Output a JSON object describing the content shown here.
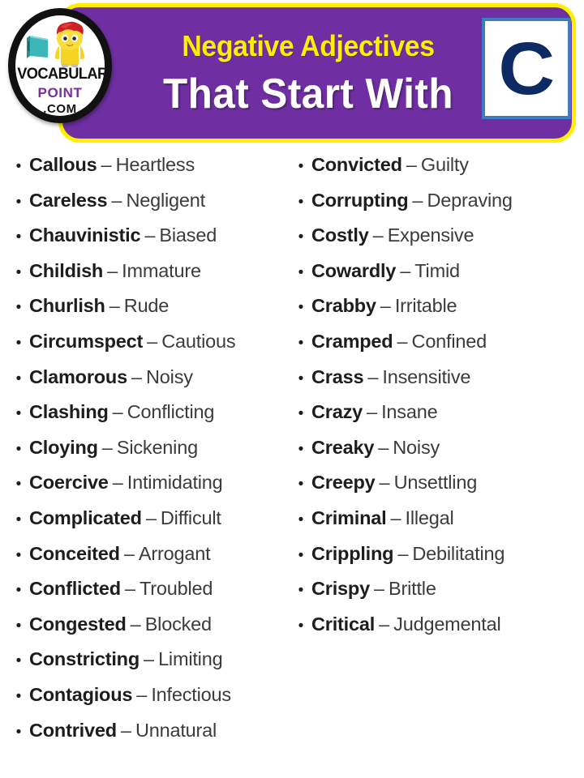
{
  "header": {
    "title_line1": "Negative Adjectives",
    "title_line2": "That Start With",
    "letter": "C",
    "banner_color": "#6f2fa2",
    "banner_border_color": "#ffee00",
    "title_line1_color": "#ffee00",
    "title_line2_color": "#ffffff",
    "letter_color": "#0d2a62",
    "letter_border_color": "#3d7cc0"
  },
  "logo": {
    "word1": "VOCABULARY",
    "word2": "POINT",
    "word3": ".COM",
    "word1_color": "#111111",
    "word2_color": "#7a2f9e",
    "word3_color": "#111111"
  },
  "list": {
    "bullet": "•",
    "dash": "–",
    "left_column": [
      {
        "term": "Callous",
        "meaning": "Heartless"
      },
      {
        "term": "Careless",
        "meaning": "Negligent"
      },
      {
        "term": "Chauvinistic",
        "meaning": "Biased"
      },
      {
        "term": "Childish",
        "meaning": "Immature"
      },
      {
        "term": "Churlish",
        "meaning": "Rude"
      },
      {
        "term": "Circumspect",
        "meaning": "Cautious"
      },
      {
        "term": "Clamorous",
        "meaning": "Noisy"
      },
      {
        "term": "Clashing",
        "meaning": "Conflicting"
      },
      {
        "term": "Cloying",
        "meaning": "Sickening"
      },
      {
        "term": "Coercive",
        "meaning": "Intimidating"
      },
      {
        "term": "Complicated",
        "meaning": "Difficult"
      },
      {
        "term": "Conceited",
        "meaning": "Arrogant"
      },
      {
        "term": "Conflicted",
        "meaning": "Troubled"
      },
      {
        "term": "Congested",
        "meaning": "Blocked"
      },
      {
        "term": "Constricting",
        "meaning": "Limiting"
      },
      {
        "term": "Contagious",
        "meaning": "Infectious"
      },
      {
        "term": "Contrived",
        "meaning": "Unnatural"
      }
    ],
    "right_column": [
      {
        "term": "Convicted",
        "meaning": "Guilty"
      },
      {
        "term": "Corrupting",
        "meaning": "Depraving"
      },
      {
        "term": "Costly",
        "meaning": "Expensive"
      },
      {
        "term": "Cowardly",
        "meaning": "Timid"
      },
      {
        "term": "Crabby",
        "meaning": "Irritable"
      },
      {
        "term": "Cramped",
        "meaning": "Confined"
      },
      {
        "term": "Crass",
        "meaning": "Insensitive"
      },
      {
        "term": "Crazy",
        "meaning": "Insane"
      },
      {
        "term": "Creaky",
        "meaning": "Noisy"
      },
      {
        "term": "Creepy",
        "meaning": "Unsettling"
      },
      {
        "term": "Criminal",
        "meaning": "Illegal"
      },
      {
        "term": "Crippling",
        "meaning": "Debilitating"
      },
      {
        "term": "Crispy",
        "meaning": "Brittle"
      },
      {
        "term": "Critical",
        "meaning": "Judgemental"
      }
    ]
  }
}
